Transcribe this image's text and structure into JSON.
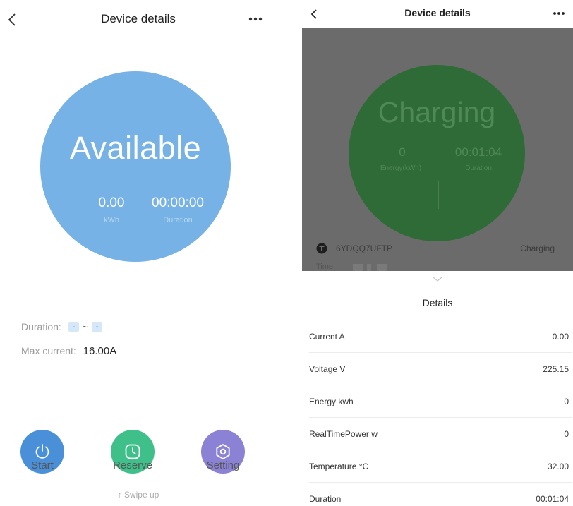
{
  "left": {
    "header": {
      "title": "Device details"
    },
    "status": {
      "text": "Available",
      "color": "#76b2e5"
    },
    "metrics": [
      {
        "value": "0.00",
        "label": "kWh"
      },
      {
        "value": "00:00:00",
        "label": "Duration"
      }
    ],
    "duration_row": {
      "label": "Duration:",
      "start": "-",
      "separator": "~",
      "end": "-"
    },
    "max_current": {
      "label": "Max current:",
      "value": "16.00A"
    },
    "actions": [
      {
        "label": "Start",
        "icon": "power-icon",
        "color": "#4a90d9"
      },
      {
        "label": "Reserve",
        "icon": "clock-icon",
        "color": "#3fbf8a"
      },
      {
        "label": "Setting",
        "icon": "gear-icon",
        "color": "#8b82d6"
      }
    ],
    "swipe_hint": "↑ Swipe up"
  },
  "right": {
    "header": {
      "title": "Device details"
    },
    "status": {
      "text": "Charging",
      "color": "#2f6b36"
    },
    "metrics": [
      {
        "value": "0",
        "label": "Energy(kWh)"
      },
      {
        "value": "00:01:04",
        "label": "Duration"
      }
    ],
    "device": {
      "id": "6YDQQ7UFTP",
      "status": "Charging"
    },
    "time_label": "Time:",
    "details_title": "Details",
    "details": [
      {
        "key": "Current A",
        "value": "0.00"
      },
      {
        "key": "Voltage V",
        "value": "225.15"
      },
      {
        "key": "Energy kwh",
        "value": "0"
      },
      {
        "key": "RealTimePower w",
        "value": "0"
      },
      {
        "key": "Temperature °C",
        "value": "32.00"
      },
      {
        "key": "Duration",
        "value": "00:01:04"
      }
    ]
  }
}
